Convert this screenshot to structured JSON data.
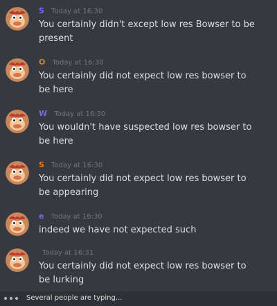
{
  "messages": [
    {
      "author": "S",
      "author_color": "#7b68ee",
      "timestamp": "Today at 16:30",
      "text": "You certainly didn't except low res Bowser to be present"
    },
    {
      "author": "O",
      "author_color": "#e67e22",
      "timestamp": "Today at 16:30",
      "text": "You certainly did not expect low res bowser to be here"
    },
    {
      "author": "W",
      "author_color": "#7b68ee",
      "timestamp": "Today at 16:30",
      "text": "You wouldn't have suspected low res bowser to be here"
    },
    {
      "author": "S",
      "author_color": "#e67e22",
      "timestamp": "Today at 16:30",
      "text": "You certainly did not expect low res bowser to be appearing"
    },
    {
      "author": "e",
      "author_color": "#7b68ee",
      "timestamp": "Today at 16:30",
      "text": "indeed we have not expected such"
    },
    {
      "author": "",
      "author_color": "#e74c3c",
      "timestamp": "Today at 16:31",
      "text": "You certainly did not expect low res bowser to be lurking"
    }
  ],
  "typing_indicator": {
    "text": "Several people are typing..."
  },
  "icons": {
    "avatar": "bowser-avatar-icon",
    "typing": "typing-dots-icon"
  }
}
